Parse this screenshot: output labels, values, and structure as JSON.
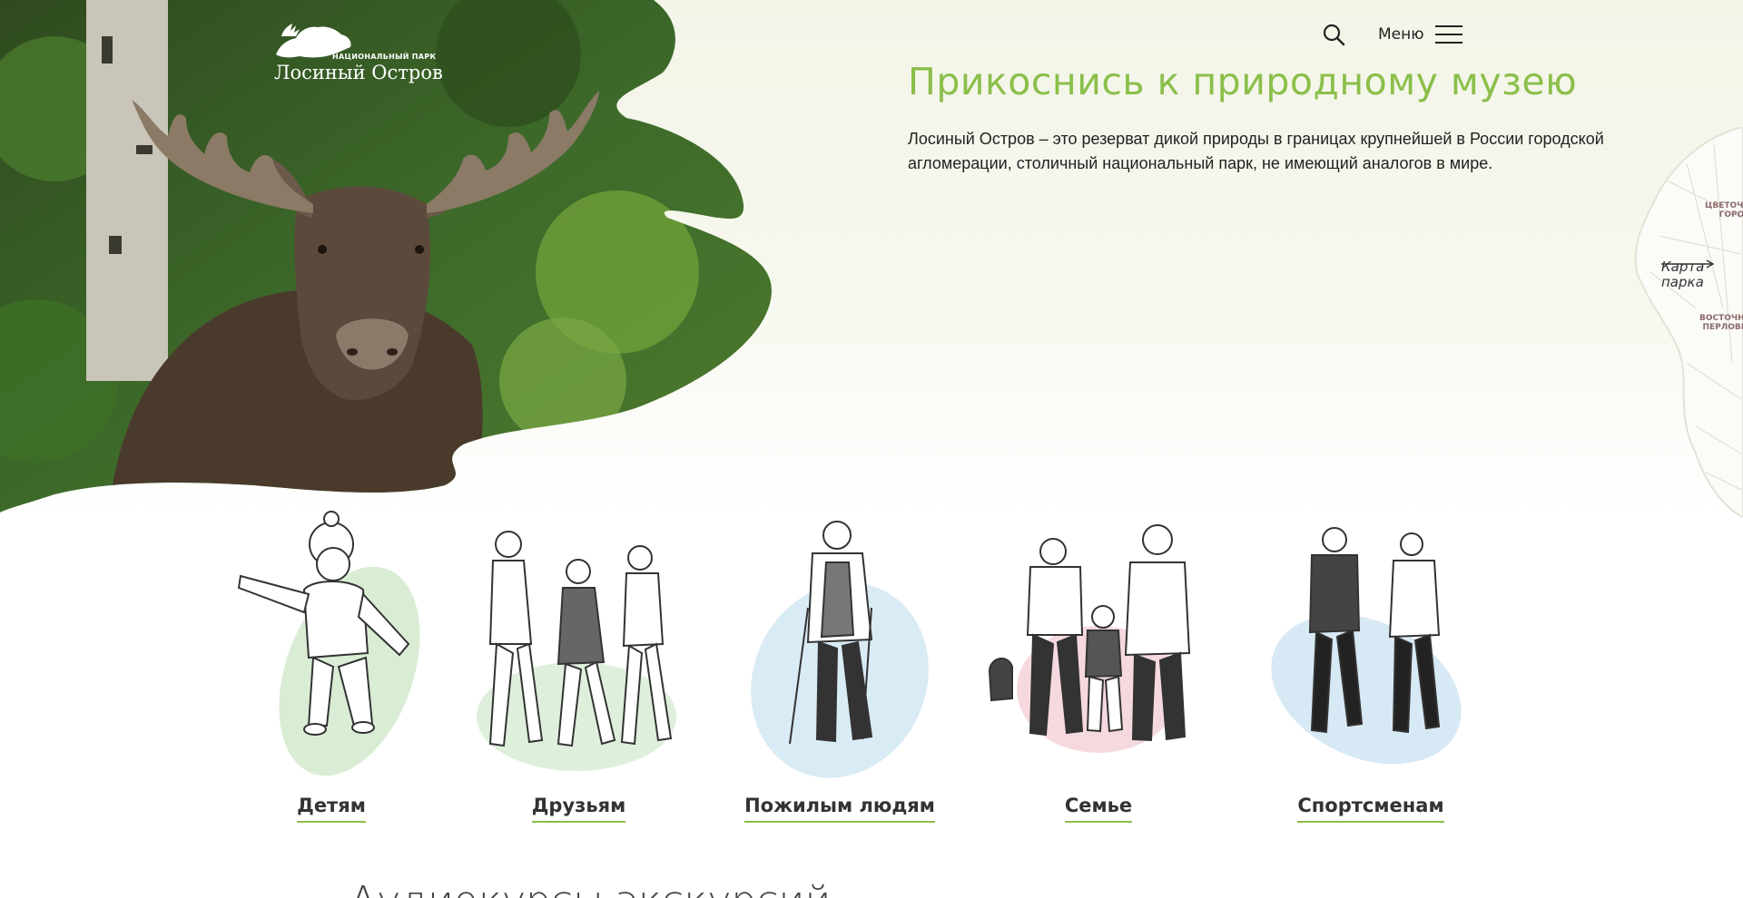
{
  "header": {
    "logo": {
      "subtitle": "НАЦИОНАЛЬНЫЙ ПАРК",
      "name": "Лосиный Остров"
    },
    "menu_label": "Меню",
    "search_icon": "search-icon",
    "menu_icon": "hamburger-icon"
  },
  "hero": {
    "title": "Прикоснись к природному музею",
    "description": "Лосиный Остров – это резерват дикой природы в границах крупнейшей в России городской агломерации, столичный национальный парк, не имеющий аналогов в мире.",
    "image": "moose-photo"
  },
  "map_tab": {
    "link_label_line1": "Карта",
    "link_label_line2": "парка",
    "place_1_line1": "ЦВЕТОЧНЫЙ",
    "place_1_line2": "ГОРОД",
    "place_2_line1": "ВОСТОЧНАЯ",
    "place_2_line2": "ПЕРЛОВКА",
    "arrow_icon": "arrow-right-icon"
  },
  "audience": {
    "items": [
      {
        "label": "Детям",
        "wash_color": "#cfe9c9"
      },
      {
        "label": "Друзьям",
        "wash_color": "#d6ecd2"
      },
      {
        "label": "Пожилым людям",
        "wash_color": "#cfe6f3"
      },
      {
        "label": "Семье",
        "wash_color": "#f4cfd6"
      },
      {
        "label": "Спортсменам",
        "wash_color": "#cde4f1"
      }
    ]
  },
  "next_section": {
    "heading": "Аудиокурсы экскурсий"
  },
  "colors": {
    "accent_green": "#8bbf4a",
    "hero_background": "#f3f5e9",
    "text": "#222222"
  }
}
